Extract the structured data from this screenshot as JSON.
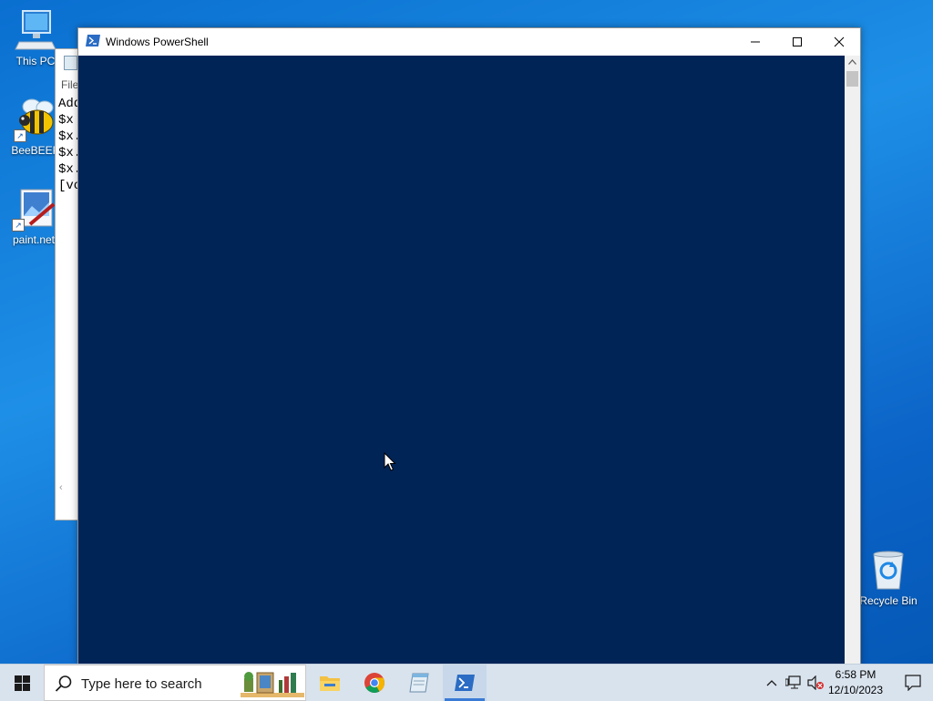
{
  "desktop": {
    "icons": [
      {
        "label": "This PC",
        "icon": "computer-icon"
      },
      {
        "label": "BeeBEEP",
        "icon": "bee-icon"
      },
      {
        "label": "paint.net",
        "icon": "paintnet-icon"
      },
      {
        "label": "Recycle Bin",
        "icon": "recycle-bin-icon"
      }
    ]
  },
  "notepad": {
    "menu_label": "File",
    "lines": [
      "Add",
      "$x ",
      "$x.",
      "$x.",
      "$x.",
      "[vo"
    ]
  },
  "powershell": {
    "title": "Windows PowerShell",
    "console_color": "#012456"
  },
  "taskbar": {
    "search_placeholder": "Type here to search",
    "apps": [
      {
        "name": "File Explorer",
        "icon": "folder-icon"
      },
      {
        "name": "Google Chrome",
        "icon": "chrome-icon"
      },
      {
        "name": "Notepad",
        "icon": "notepad-icon"
      },
      {
        "name": "Windows PowerShell",
        "icon": "powershell-icon",
        "active": true
      }
    ],
    "clock": {
      "time": "6:58 PM",
      "date": "12/10/2023"
    }
  }
}
